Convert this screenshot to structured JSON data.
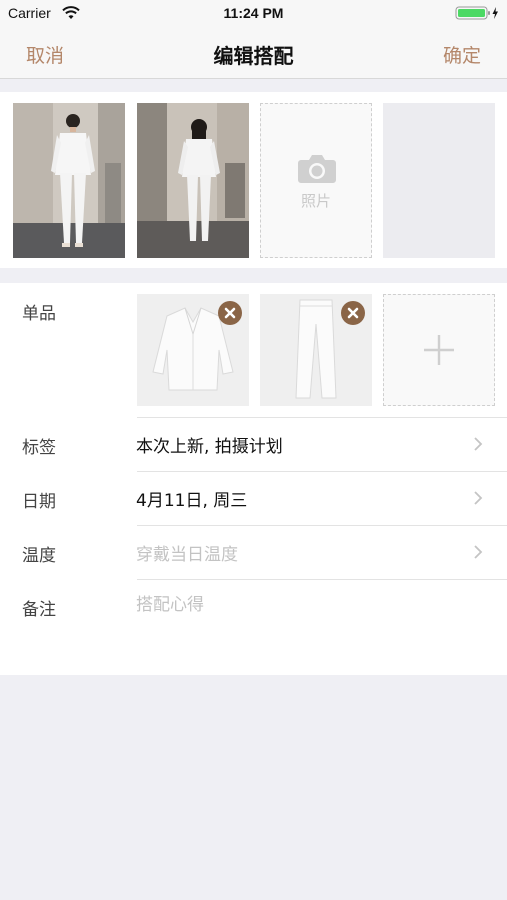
{
  "status_bar": {
    "carrier": "Carrier",
    "time": "11:24 PM",
    "icons": [
      "wifi-icon",
      "battery-icon",
      "charging-bolt-icon"
    ],
    "battery_color": "#4cd964"
  },
  "nav": {
    "cancel_label": "取消",
    "title": "编辑搭配",
    "confirm_label": "确定",
    "accent_color": "#b4876a"
  },
  "photos": {
    "placeholder_label": "照片",
    "items": [
      "photo-front-view",
      "photo-back-view"
    ]
  },
  "items_row": {
    "label": "单品",
    "items": [
      "white-jacket",
      "white-pants"
    ]
  },
  "rows": [
    {
      "label": "标签",
      "value": "本次上新, 拍摄计划",
      "is_placeholder": false
    },
    {
      "label": "日期",
      "value": "4月11日, 周三",
      "is_placeholder": false
    },
    {
      "label": "温度",
      "value": "穿戴当日温度",
      "is_placeholder": true
    },
    {
      "label": "备注",
      "value": "搭配心得",
      "is_placeholder": true
    }
  ]
}
